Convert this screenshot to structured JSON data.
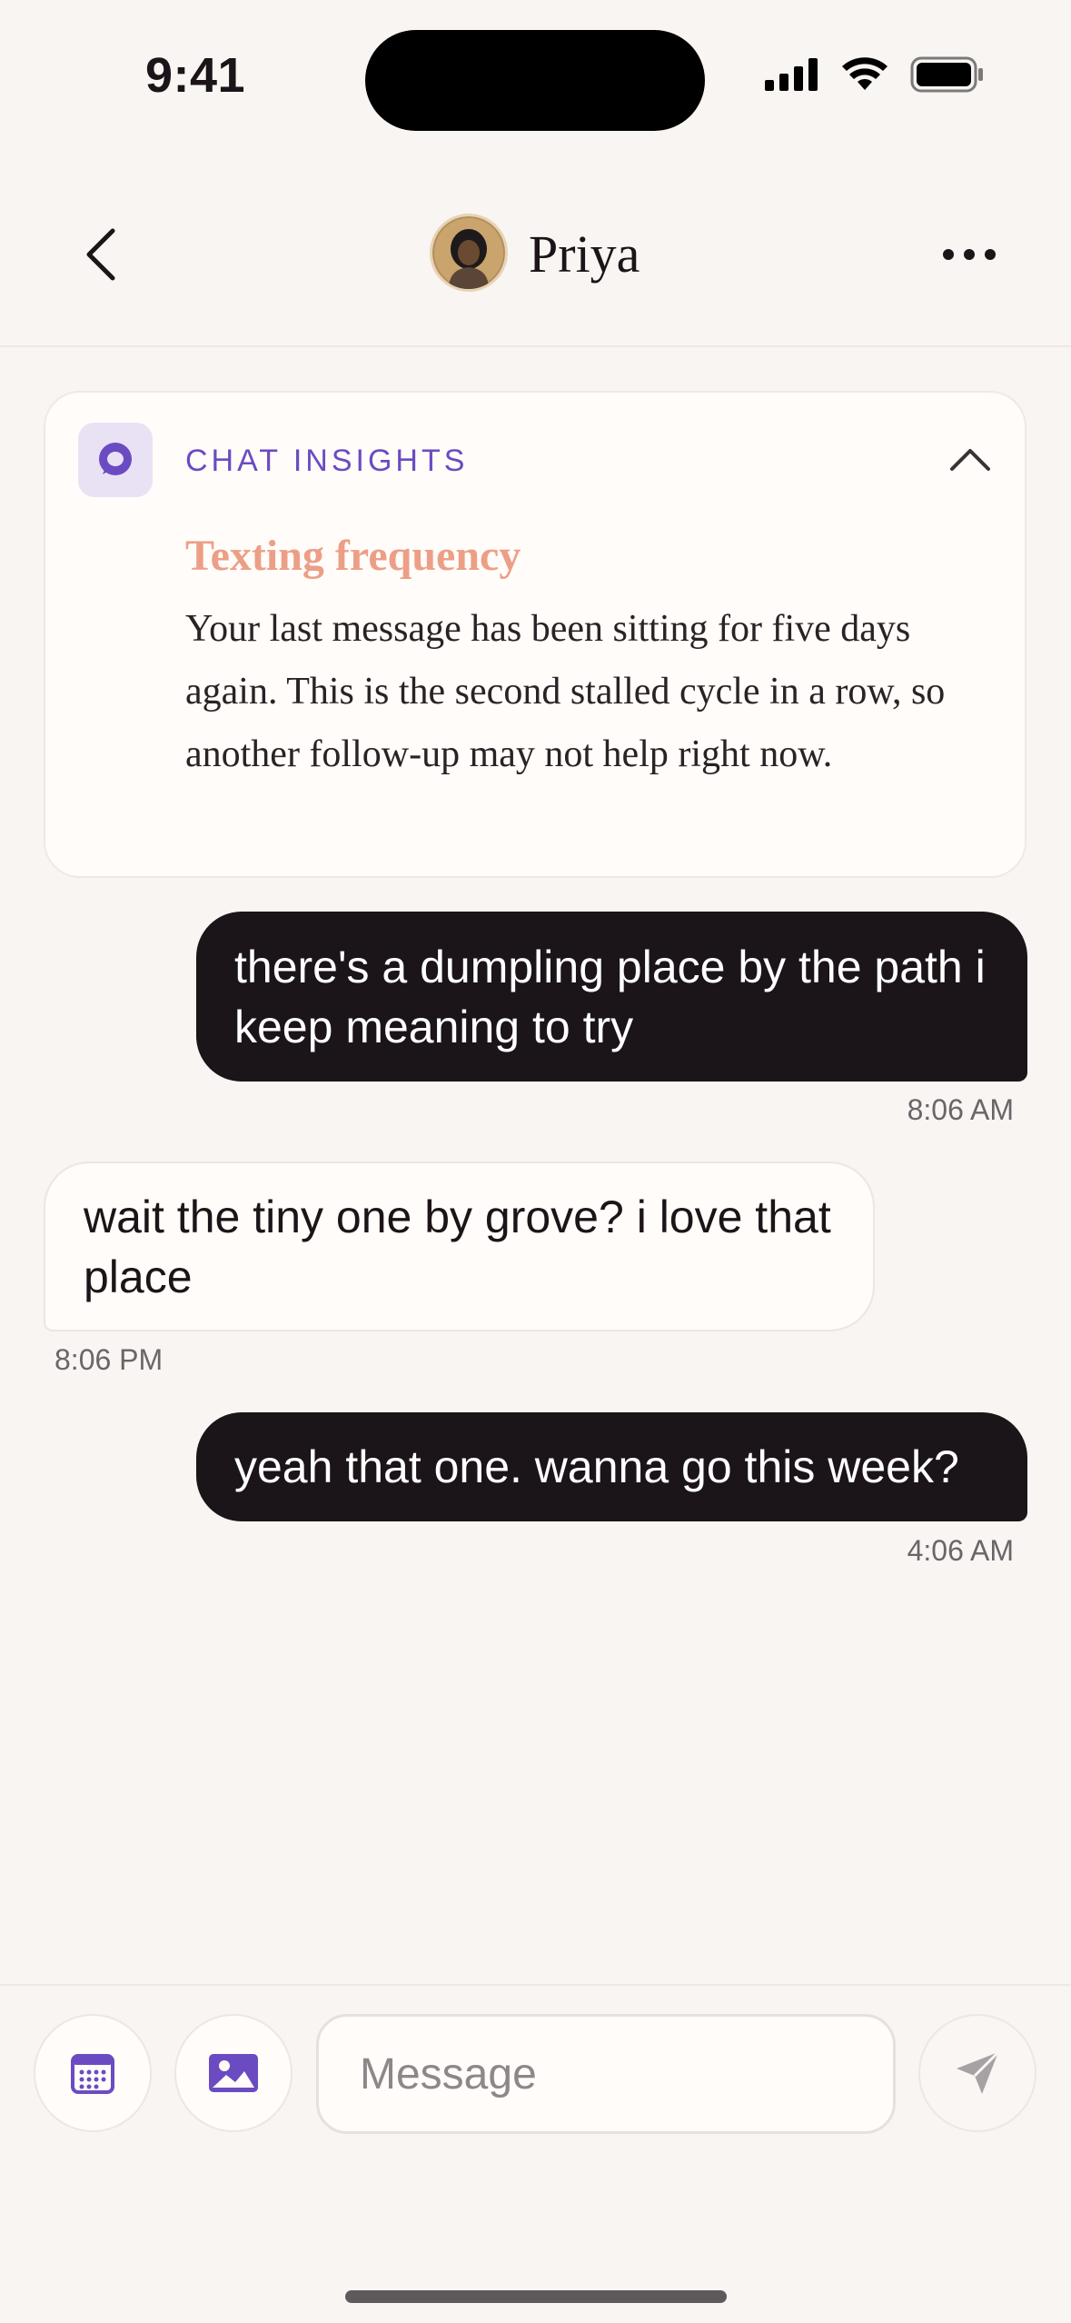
{
  "status_bar": {
    "time": "9:41",
    "icons": [
      "signal-icon",
      "wifi-icon",
      "battery-icon"
    ]
  },
  "header": {
    "contact_name": "Priya",
    "back_icon": "chevron-left-icon",
    "more_icon": "ellipsis-icon"
  },
  "insights": {
    "label": "CHAT INSIGHTS",
    "title": "Texting frequency",
    "body": "Your last message has been sitting for five days again. This is the second stalled cycle in a row, so another follow-up may not help right now.",
    "icon": "chat-bubble-icon",
    "collapse_icon": "chevron-up-icon"
  },
  "messages": [
    {
      "direction": "outgoing",
      "text": "there's a dumpling place by the path i keep meaning to try",
      "time": "8:06 AM"
    },
    {
      "direction": "incoming",
      "text": "wait the tiny one by grove? i love that place",
      "time": "8:06 PM"
    },
    {
      "direction": "outgoing",
      "text": "yeah that one. wanna go this week?",
      "time": "4:06 AM"
    }
  ],
  "composer": {
    "placeholder": "Message",
    "value": "",
    "buttons": [
      "calendar-icon",
      "image-icon",
      "send-icon"
    ]
  },
  "colors": {
    "accent_purple": "#6b4bc2",
    "insight_title": "#ec9f86",
    "outgoing_bubble": "#1b1419",
    "background": "#f8f5f2"
  }
}
